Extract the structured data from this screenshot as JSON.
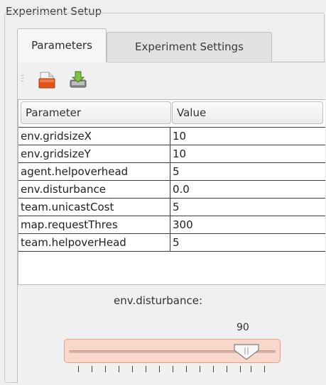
{
  "groupbox": {
    "title": "Experiment Setup"
  },
  "tabs": [
    {
      "label": "Parameters",
      "active": true
    },
    {
      "label": "Experiment Settings",
      "active": false
    }
  ],
  "toolbar": {
    "buttons": [
      {
        "icon": "open-file-icon"
      },
      {
        "icon": "save-download-icon"
      }
    ]
  },
  "table": {
    "headers": [
      "Parameter",
      "Value"
    ],
    "rows": [
      {
        "param": "env.gridsizeX",
        "value": "10"
      },
      {
        "param": "env.gridsizeY",
        "value": "10"
      },
      {
        "param": "agent.helpoverhead",
        "value": "5"
      },
      {
        "param": "env.disturbance",
        "value": "0.0"
      },
      {
        "param": "team.unicastCost",
        "value": "5"
      },
      {
        "param": "map.requestThres",
        "value": "300"
      },
      {
        "param": "team.helpoverHead",
        "value": "5"
      }
    ]
  },
  "slider": {
    "label": "env.disturbance:",
    "value": "90",
    "accent": "#f8d8cb",
    "border": "#e2a08a"
  }
}
